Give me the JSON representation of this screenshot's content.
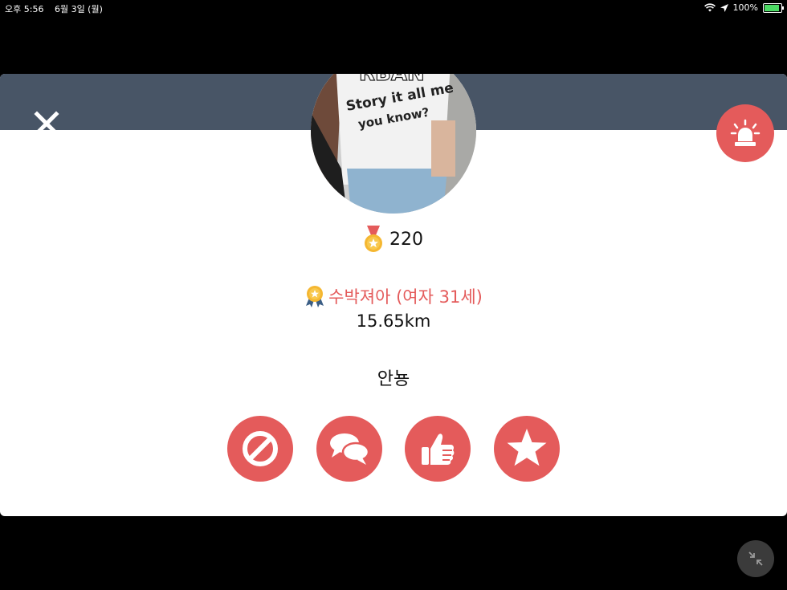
{
  "status_bar": {
    "time": "오후 5:56",
    "date": "6월 3일 (월)",
    "battery": "100%",
    "battery_level": 1.0
  },
  "profile": {
    "score": "220",
    "name_line": "수박져아 (여자 31세)",
    "distance": "15.65km",
    "bio": "안뇽",
    "photo_text_1": "RBAN",
    "photo_text_2": "Story it all me",
    "photo_text_3": "you know?"
  },
  "icons": {
    "close": "close-icon",
    "report": "siren-icon",
    "score": "medal-icon",
    "badge": "award-badge-icon",
    "block": "block-icon",
    "chat": "chat-bubbles-icon",
    "like": "thumbs-up-icon",
    "favorite": "star-icon",
    "minimize": "minimize-icon"
  },
  "colors": {
    "accent": "#e45b5b",
    "header": "#485566",
    "background": "#000000",
    "card": "#ffffff"
  }
}
